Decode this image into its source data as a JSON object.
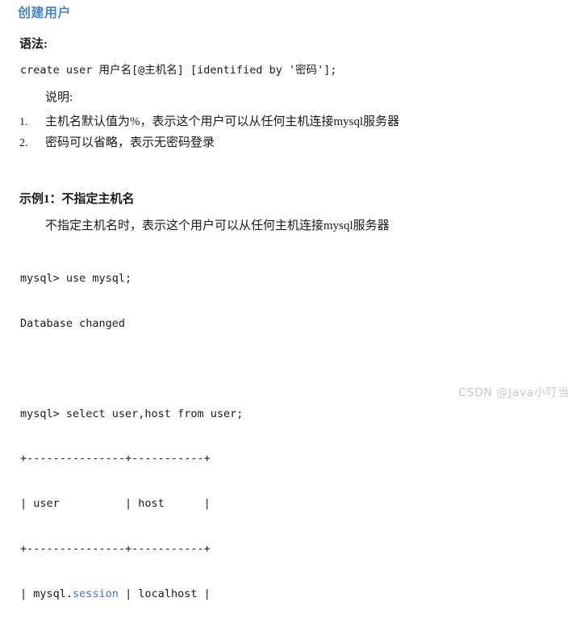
{
  "document": {
    "title": "创建用户",
    "title_color": "#4a86c8",
    "background_color": "#ffffff",
    "text_color": "#1a1a1a"
  },
  "syntax_section": {
    "heading": "语法:",
    "code": "create user 用户名[@主机名] [identified by '密码'];",
    "note_label": "说明:",
    "notes": [
      {
        "marker": "1.",
        "text": "主机名默认值为%，表示这个用户可以从任何主机连接mysql服务器"
      },
      {
        "marker": "2.",
        "text": "密码可以省略，表示无密码登录"
      }
    ]
  },
  "example_section": {
    "heading": "示例1：不指定主机名",
    "description": "不指定主机名时，表示这个用户可以从任何主机连接mysql服务器",
    "terminal": {
      "lines": [
        {
          "kind": "plain",
          "text": "mysql> use mysql;"
        },
        {
          "kind": "plain",
          "text": "Database changed"
        },
        {
          "kind": "blank",
          "text": " "
        },
        {
          "kind": "plain",
          "text": "mysql> select user,host from user;"
        },
        {
          "kind": "plain",
          "text": "+---------------+-----------+"
        },
        {
          "kind": "plain",
          "text": "| user          | host      |"
        },
        {
          "kind": "plain",
          "text": "+---------------+-----------+"
        },
        {
          "kind": "highlight",
          "pre": "| mysql.",
          "token": "session",
          "post": " | localhost |"
        }
      ]
    }
  },
  "watermark": {
    "text": "CSDN @Java小叮当",
    "color": "#c8c8c8"
  }
}
